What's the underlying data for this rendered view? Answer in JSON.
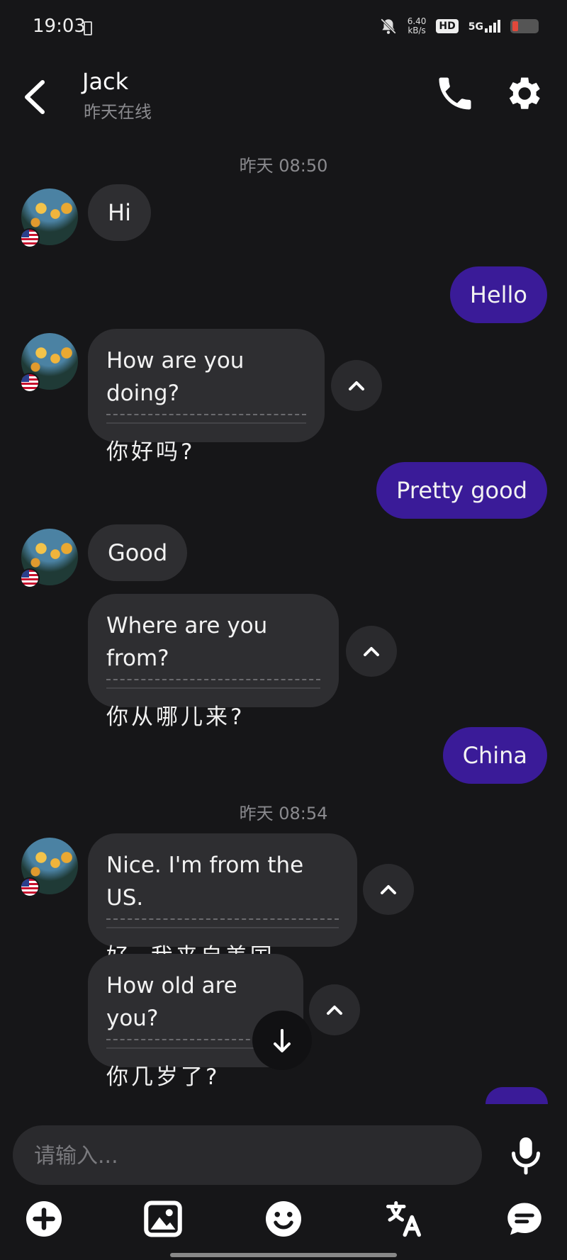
{
  "status_bar": {
    "time": "19:03",
    "net_speed_value": "6.40",
    "net_speed_unit": "kB/s",
    "hd": "HD",
    "network": "5G",
    "icons": [
      "sim-card-icon",
      "mute-bell-icon",
      "signal-bars-icon",
      "battery-low-icon"
    ]
  },
  "header": {
    "contact_name": "Jack",
    "status": "昨天在线",
    "icons": [
      "back-arrow-icon",
      "phone-icon",
      "gear-icon"
    ]
  },
  "messages": {
    "ts1": "昨天 08:50",
    "m1": "Hi",
    "m2": "Hello",
    "m3_orig": "How are you doing?",
    "m3_trans": "你好吗?",
    "m4": "Pretty good",
    "m5": "Good",
    "m6_orig": "Where are you from?",
    "m6_trans": "你从哪儿来?",
    "m7": "China",
    "ts2": "昨天 08:54",
    "m8_orig": "Nice. I'm from the US.",
    "m8_trans": "好. 我来自美国.",
    "m9_orig": "How old are you?",
    "m9_trans": "你几岁了?"
  },
  "input": {
    "placeholder": "请输入..."
  },
  "toolbar": {
    "icons": [
      "add-icon",
      "image-icon",
      "emoji-icon",
      "translate-icon",
      "chat-icon"
    ]
  },
  "colors": {
    "background": "#161618",
    "incoming_bubble": "#2e2e31",
    "outgoing_bubble": "#3a1b98",
    "muted_text": "#8a8a8e"
  }
}
